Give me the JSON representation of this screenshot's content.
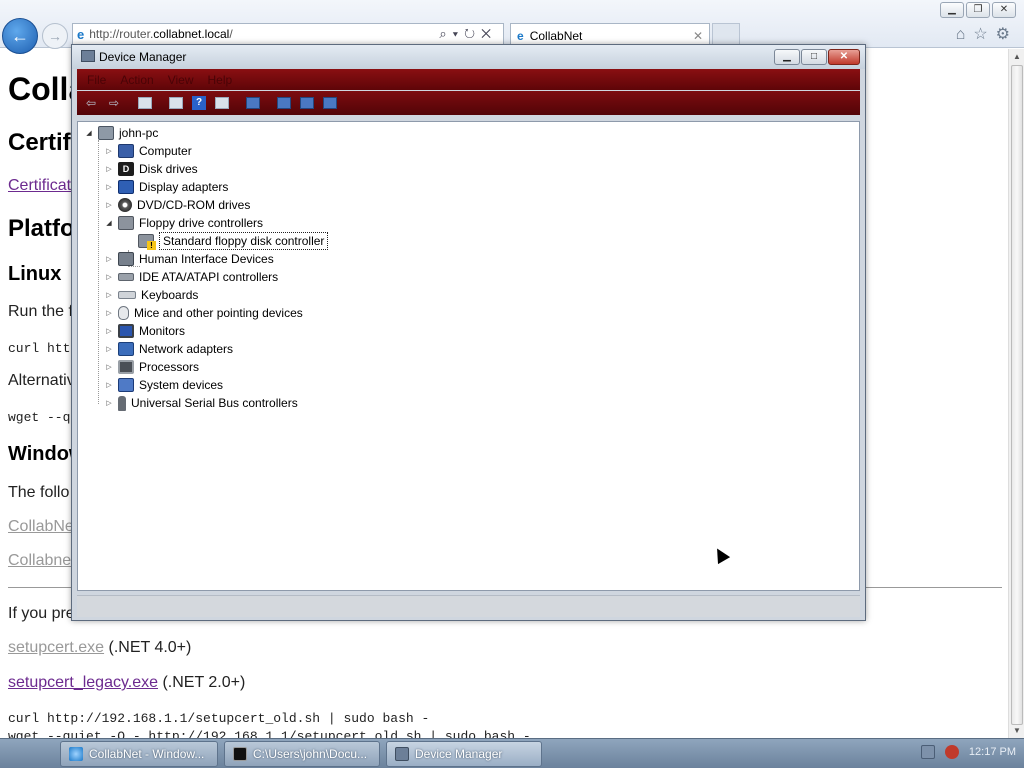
{
  "browser": {
    "address_prefix": "http://router.",
    "address_domain": "collabnet.local",
    "address_suffix": "/",
    "tab_title": "CollabNet",
    "win_min": "▁",
    "win_max": "❐",
    "win_close": "✕"
  },
  "webpage": {
    "title": "Colla",
    "section1": "Certif",
    "link_cert": "Certificat",
    "section2": "Platfo",
    "linux_heading": "Linux",
    "run_text": "Run the f",
    "curl1": "curl htt",
    "alt_text": "Alternativ",
    "wget1": "wget --q",
    "windows_heading": "Window",
    "follow_text": "The follo",
    "link_collabnet1": "CollabNe",
    "link_collabnet2": "Collabne",
    "prefer_text": "If you pre",
    "link_setupcert": "setupcert.exe",
    "setupcert_note": " (.NET 4.0+)",
    "link_setupcert_legacy": "setupcert_legacy.exe",
    "setupcert_legacy_note": " (.NET 2.0+)",
    "curl2": "curl http://192.168.1.1/setupcert_old.sh | sudo bash -",
    "wget2": "wget --quiet -O - http://192.168.1.1/setupcert_old.sh | sudo bash -"
  },
  "device_manager": {
    "title": "Device Manager",
    "menus": [
      "File",
      "Action",
      "View",
      "Help"
    ],
    "root": "john-pc",
    "categories": [
      {
        "label": "Computer",
        "icon": "computer-icon"
      },
      {
        "label": "Disk drives",
        "icon": "disk-drive-icon"
      },
      {
        "label": "Display adapters",
        "icon": "display-adapter-icon"
      },
      {
        "label": "DVD/CD-ROM drives",
        "icon": "dvd-icon"
      },
      {
        "label": "Floppy drive controllers",
        "icon": "floppy-controller-icon",
        "expanded": true
      },
      {
        "label": "Human Interface Devices",
        "icon": "hid-icon"
      },
      {
        "label": "IDE ATA/ATAPI controllers",
        "icon": "ide-controller-icon"
      },
      {
        "label": "Keyboards",
        "icon": "keyboard-icon"
      },
      {
        "label": "Mice and other pointing devices",
        "icon": "mouse-icon"
      },
      {
        "label": "Monitors",
        "icon": "monitor-icon"
      },
      {
        "label": "Network adapters",
        "icon": "network-adapter-icon"
      },
      {
        "label": "Processors",
        "icon": "processor-icon"
      },
      {
        "label": "System devices",
        "icon": "system-devices-icon"
      },
      {
        "label": "Universal Serial Bus controllers",
        "icon": "usb-icon"
      }
    ],
    "floppy_child": "Standard floppy disk controller"
  },
  "taskbar": {
    "items": [
      {
        "label": "CollabNet - Window..."
      },
      {
        "label": "C:\\Users\\john\\Docu..."
      },
      {
        "label": "Device Manager"
      }
    ],
    "clock": "12:17 PM"
  },
  "colors": {
    "menubar_bg": "#6e0a0d",
    "link_visited": "#6c2a8f",
    "ie_blue": "#1b79c9"
  }
}
